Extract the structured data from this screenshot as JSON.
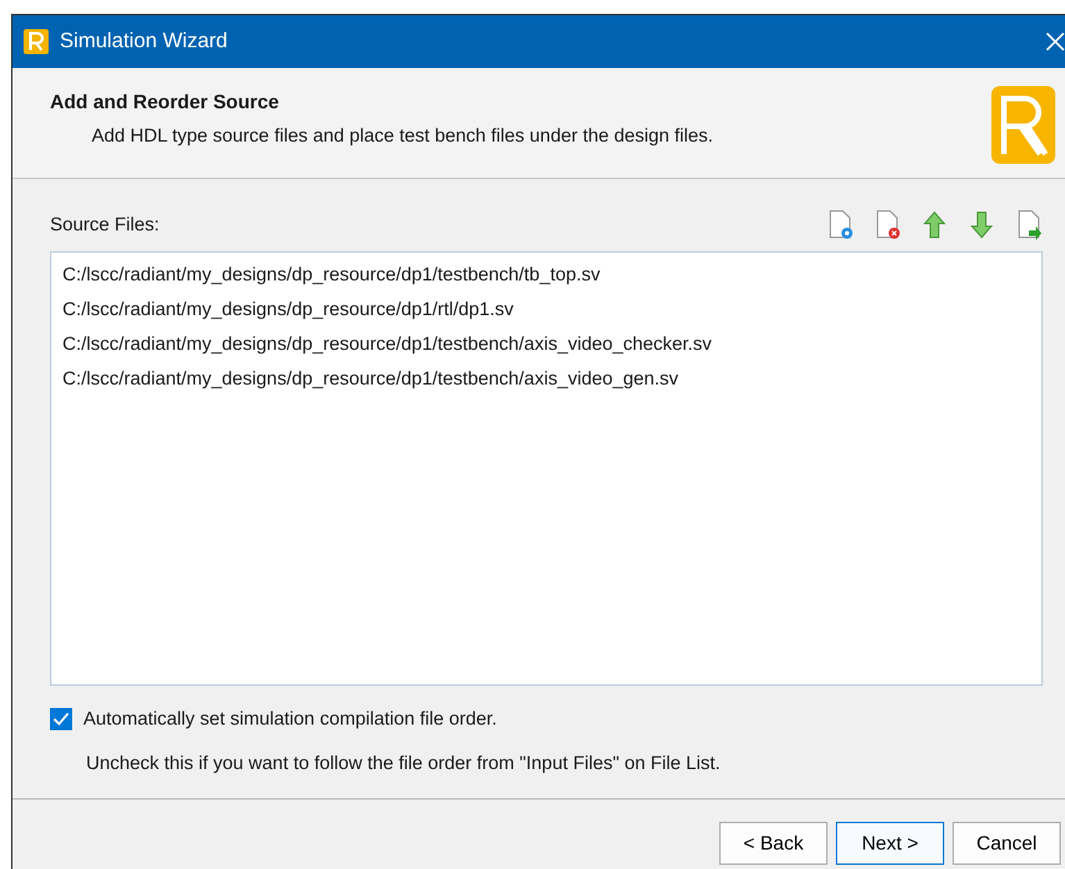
{
  "window": {
    "title": "Simulation Wizard"
  },
  "header": {
    "title": "Add and Reorder Source",
    "subtitle": "Add HDL type source files and place test bench files under the design files."
  },
  "source_files": {
    "label": "Source Files:",
    "files": [
      {
        "path": "C:/lscc/radiant/my_designs/dp_resource/dp1/testbench/tb_top.sv"
      },
      {
        "path": "C:/lscc/radiant/my_designs/dp_resource/dp1/rtl/dp1.sv"
      },
      {
        "path": "C:/lscc/radiant/my_designs/dp_resource/dp1/testbench/axis_video_checker.sv"
      },
      {
        "path": "C:/lscc/radiant/my_designs/dp_resource/dp1/testbench/axis_video_gen.sv"
      }
    ]
  },
  "auto_order": {
    "label": "Automatically set simulation compilation file order.",
    "checked": true
  },
  "note": "Uncheck this if you want to follow the file order from \"Input Files\" on File List.",
  "buttons": [
    {
      "label": "< Back",
      "default": false
    },
    {
      "label": "Next >",
      "default": true
    },
    {
      "label": "Cancel",
      "default": false
    }
  ]
}
